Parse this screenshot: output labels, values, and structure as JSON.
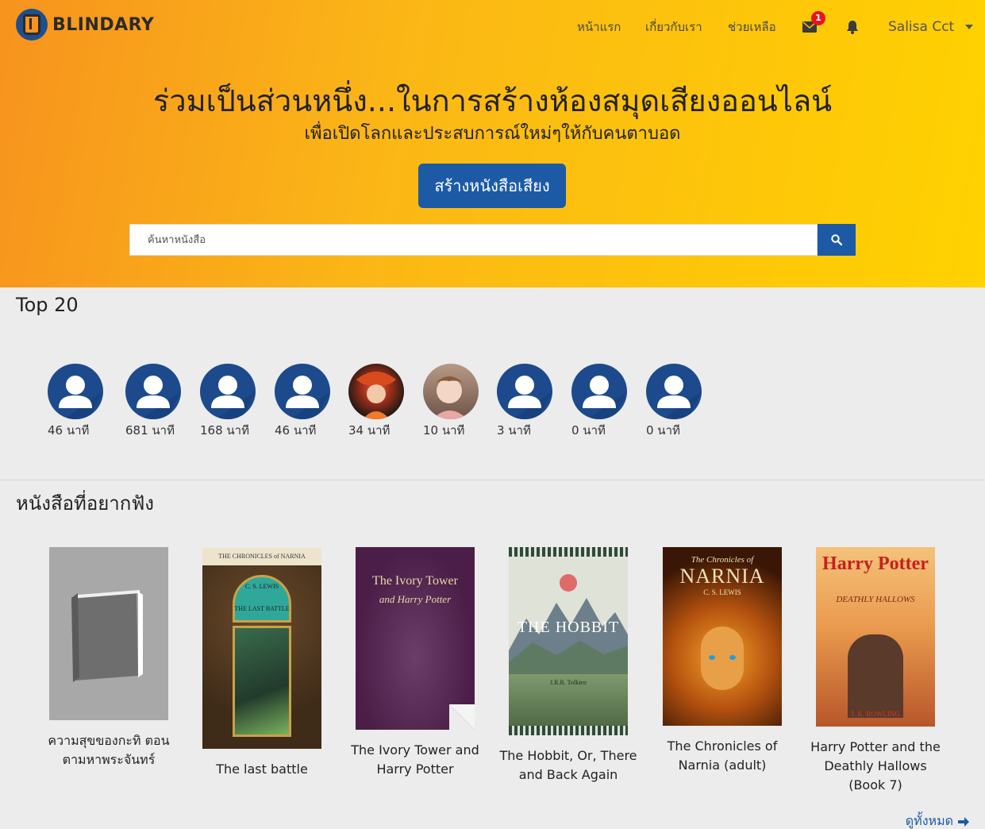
{
  "brand": {
    "name": "BLINDARY"
  },
  "nav": {
    "home": "หน้าแรก",
    "about": "เกี่ยวกับเรา",
    "help": "ช่วยเหลือ",
    "mail_badge": "1",
    "user": "Salisa Cct"
  },
  "hero": {
    "title": "ร่วมเป็นส่วนหนึ่ง...ในการสร้างห้องสมุดเสียงออนไลน์",
    "subtitle": "เพื่อเปิดโลกและประสบการณ์ใหม่ๆให้กับคนตาบอด",
    "create_button": "สร้างหนังสือเสียง",
    "search_placeholder": "ค้นหาหนังสือ"
  },
  "top20": {
    "title": "Top 20",
    "items": [
      {
        "minutes": "46 นาที",
        "avatar": "default"
      },
      {
        "minutes": "681 นาที",
        "avatar": "default"
      },
      {
        "minutes": "168 นาที",
        "avatar": "default"
      },
      {
        "minutes": "46 นาที",
        "avatar": "default"
      },
      {
        "minutes": "34 นาที",
        "avatar": "photo-art"
      },
      {
        "minutes": "10 นาที",
        "avatar": "photo-child"
      },
      {
        "minutes": "3 นาที",
        "avatar": "default"
      },
      {
        "minutes": "0 นาที",
        "avatar": "default"
      },
      {
        "minutes": "0 นาที",
        "avatar": "default"
      }
    ]
  },
  "books": {
    "title": "หนังสือที่อยากฟัง",
    "see_all": "ดูทั้งหมด",
    "items": [
      {
        "title": "ความสุขของกะทิ ตอนตามหาพระจันทร์",
        "cover_text": ""
      },
      {
        "title": "The last battle",
        "cover_text": "THE CHRONICLES of NARNIA",
        "cover_author": "C. S. LEWIS",
        "cover_sub": "THE LAST BATTLE"
      },
      {
        "title": "The Ivory Tower and Harry Potter",
        "cover_text": "The Ivory Tower",
        "cover_sub": "and Harry Potter"
      },
      {
        "title": "The Hobbit, Or, There and Back Again",
        "cover_text": "THE HOBBIT",
        "cover_author": "J.R.R. Tolkien"
      },
      {
        "title": "The Chronicles of Narnia (adult)",
        "cover_text": "NARNIA",
        "cover_sub": "The Chronicles of",
        "cover_author": "C. S. LEWIS"
      },
      {
        "title": "Harry Potter and the Deathly Hallows (Book 7)",
        "cover_text": "Harry Potter",
        "cover_sub": "DEATHLY HALLOWS",
        "cover_author": "J. K. ROWLING"
      }
    ]
  },
  "colors": {
    "primary": "#1c5aa6",
    "badge": "#e8151b"
  }
}
